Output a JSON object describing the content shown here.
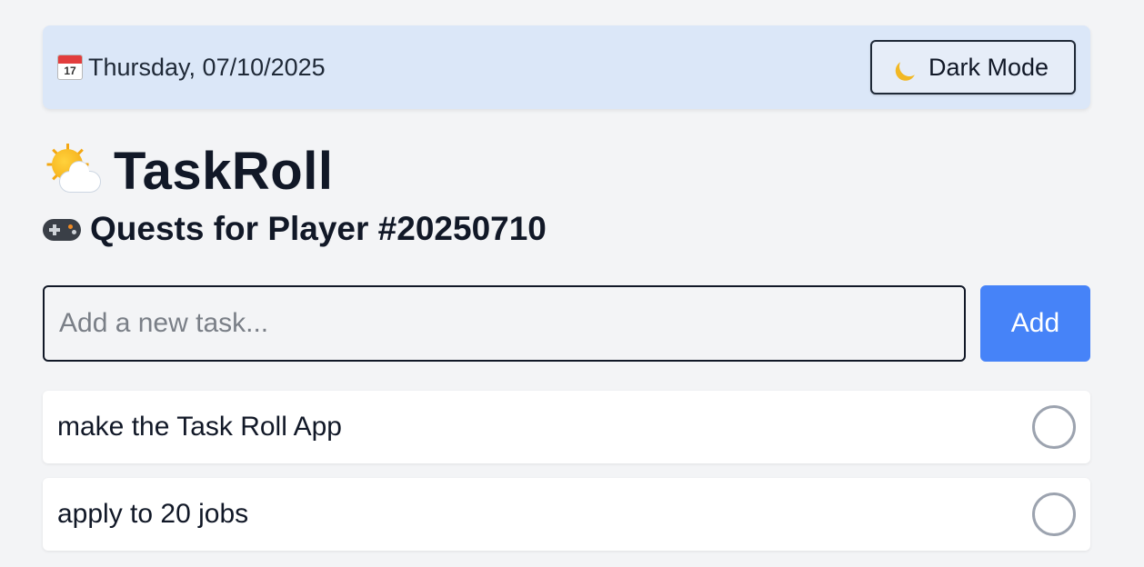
{
  "header": {
    "date_text": "Thursday, 07/10/2025",
    "calendar_day": "17",
    "dark_mode_label": "Dark Mode"
  },
  "app": {
    "title": "TaskRoll",
    "subtitle": "Quests for Player #20250710"
  },
  "new_task": {
    "placeholder": "Add a new task...",
    "value": "",
    "add_label": "Add"
  },
  "tasks": [
    {
      "text": "make the Task Roll App",
      "done": false
    },
    {
      "text": "apply to 20 jobs",
      "done": false
    }
  ],
  "icons": {
    "calendar": "calendar-icon",
    "dark_mode": "crescent-moon-icon",
    "title": "sun-behind-cloud-icon",
    "subtitle": "video-game-controller-icon",
    "task_status": "empty-circle-icon"
  },
  "colors": {
    "background": "#f3f4f6",
    "topbar": "#dbe7f8",
    "accent": "#4683f8",
    "text": "#111827",
    "check_border": "#9ca3af"
  }
}
